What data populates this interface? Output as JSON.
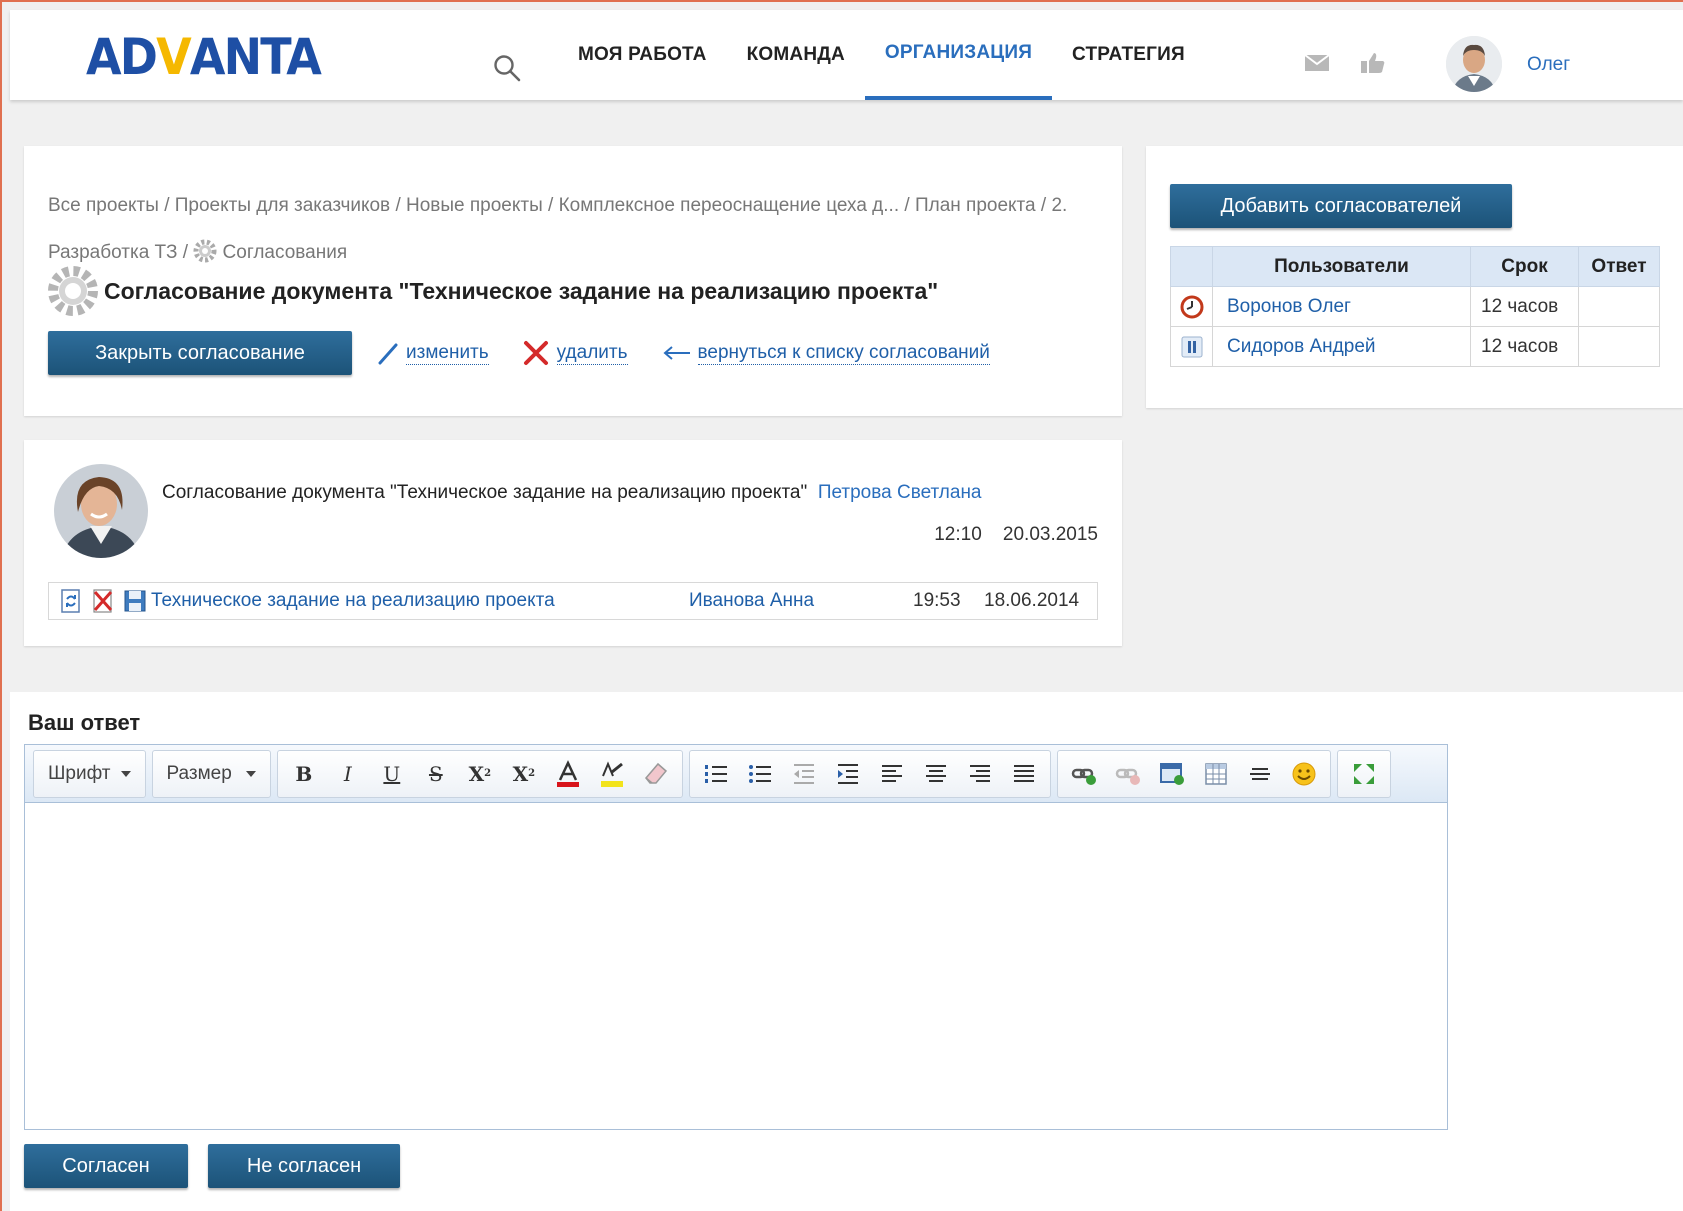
{
  "header": {
    "logo_left": "AD",
    "logo_mid": "V",
    "logo_right": "ANTA",
    "nav": [
      "МОЯ РАБОТА",
      "КОМАНДА",
      "ОРГАНИЗАЦИЯ",
      "СТРАТЕГИЯ"
    ],
    "active_nav": "ОРГАНИЗАЦИЯ",
    "user_name": "Олег"
  },
  "breadcrumbs": {
    "items": [
      "Все проекты",
      "Проекты для заказчиков",
      "Новые проекты",
      "Комплексное переоснащение цеха д...",
      "План проекта",
      "2. Разработка ТЗ",
      "Согласования"
    ]
  },
  "approval": {
    "title": "Согласование документа \"Техническое задание на реализацию проекта\"",
    "close_button": "Закрыть согласование",
    "edit_link": "изменить",
    "delete_link": "удалить",
    "back_link": "вернуться к списку согласований"
  },
  "message": {
    "text": "Согласование документа \"Техническое задание на реализацию проекта\"",
    "author": "Петрова Светлана",
    "time": "12:10",
    "date": "20.03.2015",
    "attachment": {
      "name": "Техническое задание на реализацию проекта",
      "author": "Иванова Анна",
      "time": "19:53",
      "date": "18.06.2014"
    }
  },
  "approvers": {
    "add_button": "Добавить согласователей",
    "columns": [
      "Пользователи",
      "Срок",
      "Ответ"
    ],
    "rows": [
      {
        "user": "Воронов Олег",
        "term": "12 часов",
        "answer": "",
        "status_icon": "clock-icon"
      },
      {
        "user": "Сидоров Андрей",
        "term": "12 часов",
        "answer": "",
        "status_icon": "pause-icon"
      }
    ]
  },
  "answer": {
    "title": "Ваш ответ",
    "font_combo": "Шрифт",
    "size_combo": "Размер",
    "agree_button": "Согласен",
    "disagree_button": "Не согласен"
  },
  "colors": {
    "accent": "#2a6ebd",
    "button": "#1c5378",
    "logo_blue": "#1e4fa5",
    "logo_yellow": "#f5b800"
  }
}
